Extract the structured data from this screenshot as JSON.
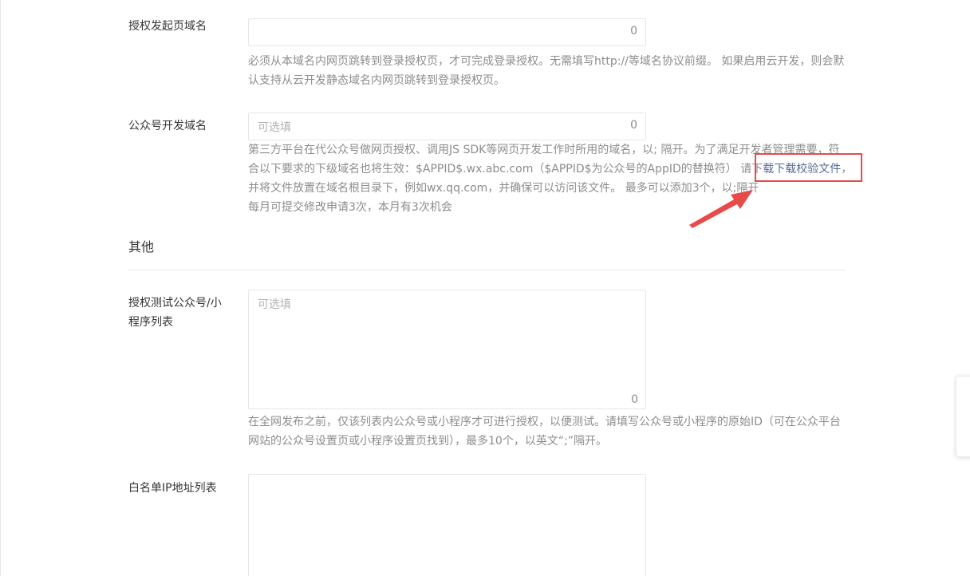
{
  "fields": {
    "auth_domain": {
      "label": "授权发起页域名",
      "counter": "0",
      "help": "必须从本域名内网页跳转到登录授权页，才可完成登录授权。无需填写http://等域名协议前缀。 如果启用云开发，则会默认支持从云开发静态域名内网页跳转到登录授权页。"
    },
    "mp_dev_domain": {
      "label": "公众号开发域名",
      "placeholder": "可选填",
      "counter": "0",
      "help_line1": "第三方平台在代公众号做网页授权、调用JS SDK等网页开发工作时所用的域名，以; 隔开。为了满足开发者管理需要，符",
      "help_line2_pre": "合以下要求的下级域名也将生效：$APPID$.wx.abc.com（$APPID$为公众号的AppID的替换符） 请下",
      "help_line2_link": "载下载校验文件",
      "help_line2_post": "，",
      "help_line3": "并将文件放置在域名根目录下，例如wx.qq.com，并确保可以访问该文件。 最多可以添加3个，以;隔开",
      "help_line4": "每月可提交修改申请3次，本月有3次机会"
    },
    "test_list": {
      "label": "授权测试公众号/小程序列表",
      "placeholder": "可选填",
      "counter": "0",
      "help": "在全网发布之前，仅该列表内公众号或小程序才可进行授权，以便测试。请填写公众号或小程序的原始ID（可在公众平台网站的公众号设置页或小程序设置页找到），最多10个，以英文“;”隔开。"
    },
    "ip_whitelist": {
      "label": "白名单IP地址列表"
    }
  },
  "section_other": {
    "title": "其他"
  },
  "colors": {
    "link": "#576b95",
    "highlight": "#e84a4a",
    "help_text": "#8d8d8d"
  }
}
